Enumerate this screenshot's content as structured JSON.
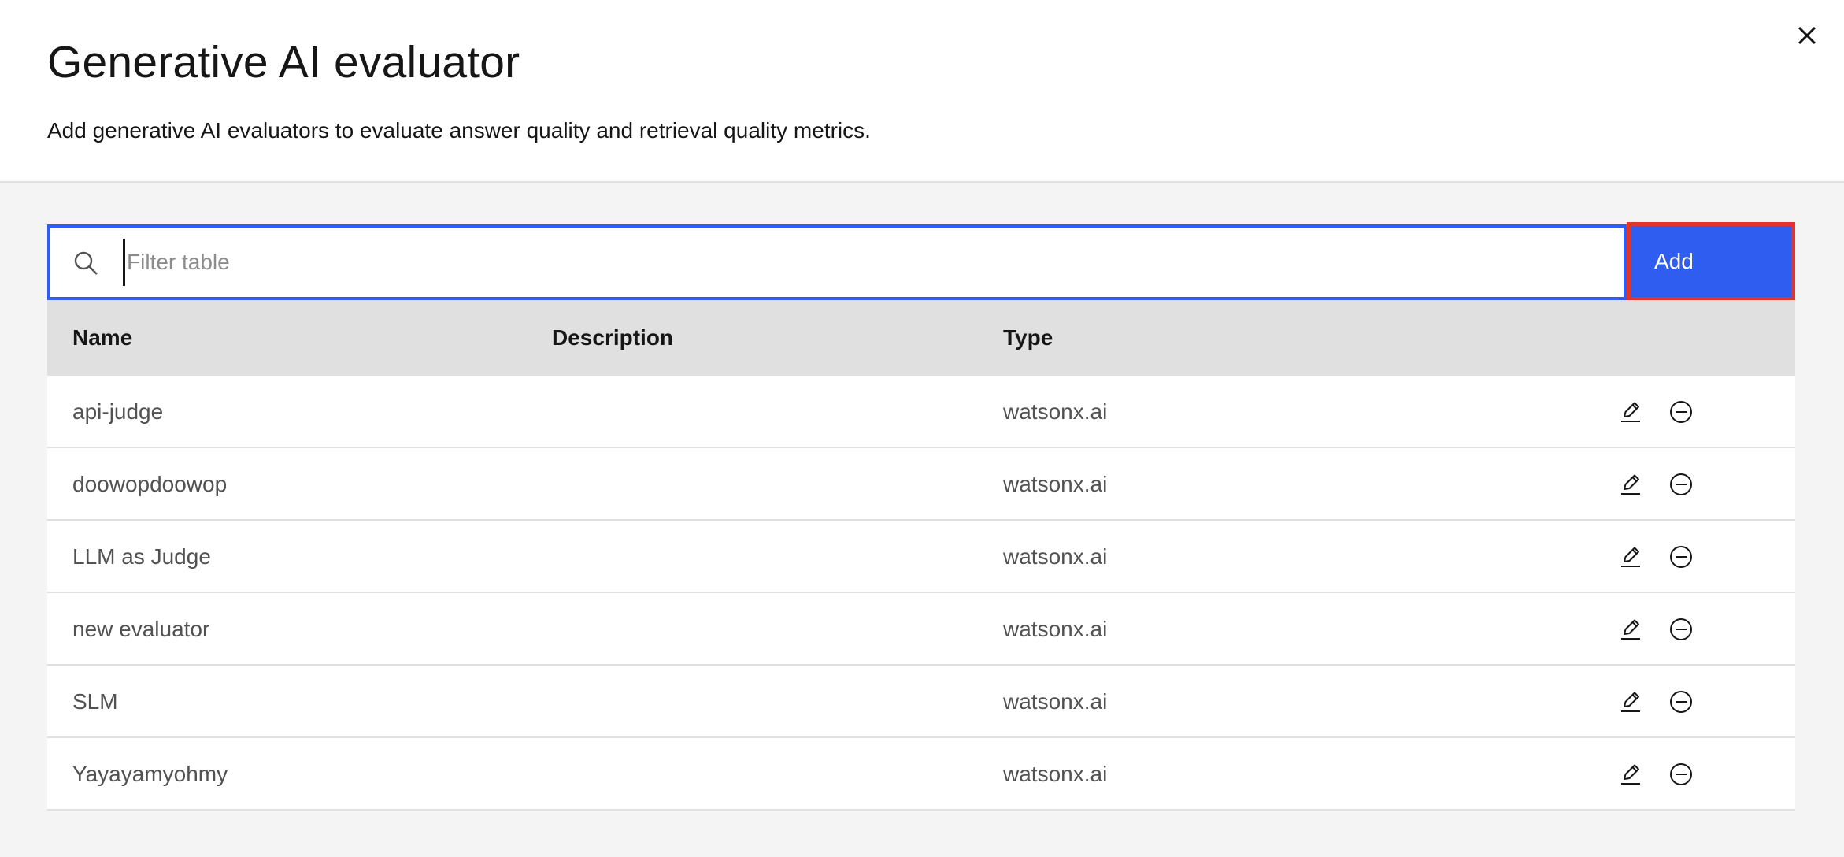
{
  "modal": {
    "title": "Generative AI evaluator",
    "subtitle": "Add generative AI evaluators to evaluate answer quality and retrieval quality metrics.",
    "close_icon": "close-icon"
  },
  "toolbar": {
    "search_placeholder": "Filter table",
    "search_value": "",
    "add_label": "Add"
  },
  "table": {
    "columns": [
      "Name",
      "Description",
      "Type"
    ],
    "rows": [
      {
        "name": "api-judge",
        "description": "",
        "type": "watsonx.ai"
      },
      {
        "name": "doowopdoowop",
        "description": "",
        "type": "watsonx.ai"
      },
      {
        "name": "LLM as Judge",
        "description": "",
        "type": "watsonx.ai"
      },
      {
        "name": "new evaluator",
        "description": "",
        "type": "watsonx.ai"
      },
      {
        "name": "SLM",
        "description": "",
        "type": "watsonx.ai"
      },
      {
        "name": "Yayayamyohmy",
        "description": "",
        "type": "watsonx.ai"
      }
    ],
    "row_actions": [
      "edit-icon",
      "remove-icon"
    ]
  },
  "colors": {
    "accent": "#2f5df0",
    "highlight_border": "#e0342c",
    "header_bg": "#e0e0e0",
    "page_bg": "#f4f4f4"
  }
}
